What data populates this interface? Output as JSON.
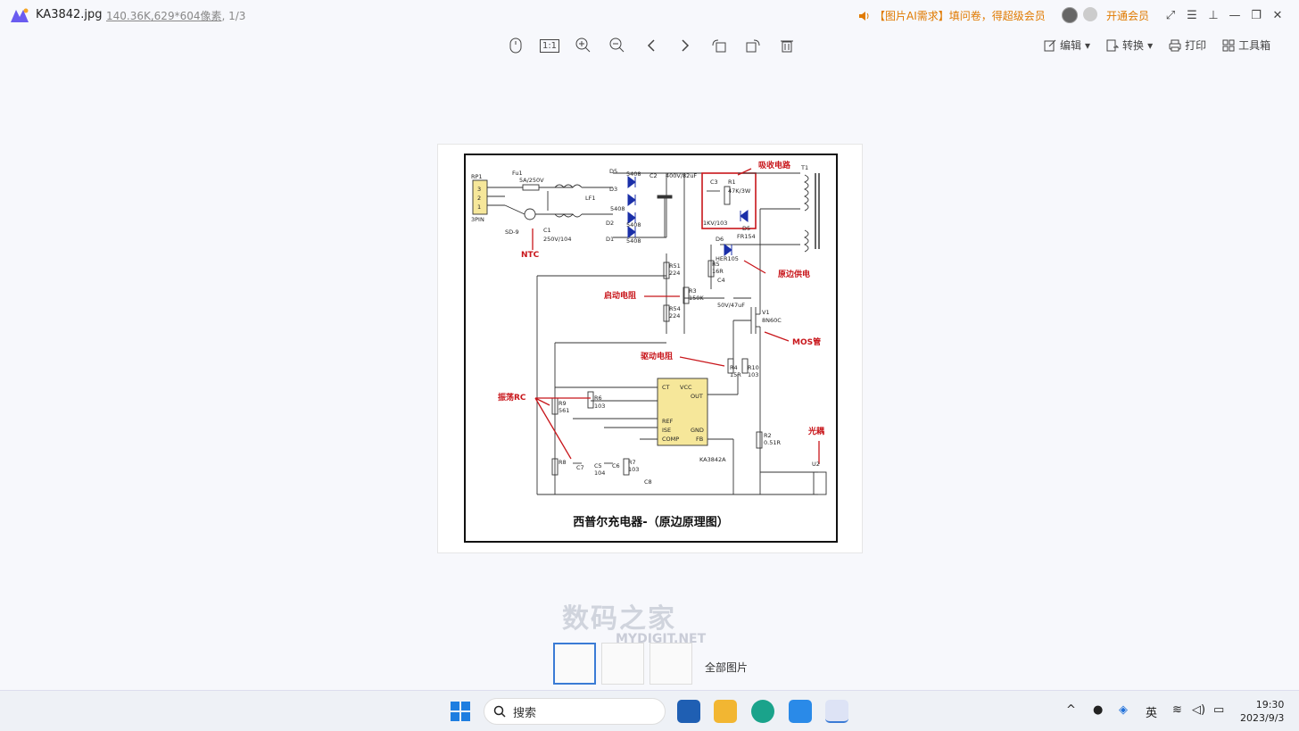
{
  "titlebar": {
    "filename": "KA3842.jpg",
    "size": "140.36K",
    "dims": ",629*604像素",
    "index": ", 1/3",
    "promo": "【图片AI需求】填问卷，得超级会员",
    "vip": "开通会员"
  },
  "toolbar": {
    "ratio_label": "1:1",
    "edit": "编辑",
    "convert": "转换",
    "print": "打印",
    "toolbox": "工具箱"
  },
  "schematic": {
    "caption": "西普尔充电器-（原边原理图）",
    "labels": {
      "rp": "RP1",
      "p3": "3",
      "p2": "2",
      "p1": "1",
      "pin": "3PIN",
      "fu": "Fu1",
      "fuv": "5A/250V",
      "sd": "SD-9",
      "ntc": "NTC",
      "c1": "C1",
      "c1v": "250V/104",
      "lf": "LF1",
      "d5": "D5",
      "d3": "D3",
      "d2": "D2",
      "d1": "D1",
      "d5v": "5408",
      "d3v": "5408",
      "d2v": "5408",
      "d1v": "5408",
      "c2": "C2",
      "c2v": "400V/82uF",
      "absorb": "吸收电路",
      "c3": "C3",
      "r1": "R1",
      "r1v": "47K/3W",
      "c3v": "1KV/103",
      "d5b": "D5",
      "fr": "FR154",
      "t1": "T1",
      "d6": "D6",
      "her": "HER105",
      "primary": "原边供电",
      "r51": "R51",
      "r51v": "224",
      "r5": "R5",
      "r5v": "16R",
      "c4": "C4",
      "startup": "启动电阻",
      "r3": "R3",
      "r3v": "150K",
      "c4v": "50V/47uF",
      "r54": "R54",
      "r54v": "224",
      "v1": "V1",
      "v1v": "8N60C",
      "mos": "MOS管",
      "drive": "驱动电阻",
      "r4": "R4",
      "r4v": "15R",
      "r10": "R10",
      "r10v": "103",
      "osc": "振荡RC",
      "r9": "R9",
      "r9v": "561",
      "r6": "R6",
      "r6v": "103",
      "ct": "CT",
      "vcc": "VCC",
      "out": "OUT",
      "ref": "REF",
      "ise": "ISE",
      "comp": "COMP",
      "gnd": "GND",
      "fb": "FB",
      "ic": "KA3842A",
      "r2": "R2",
      "r2v": "0.51R",
      "opto": "光耦",
      "u2": "U2",
      "r8": "R8",
      "c7": "C7",
      "c5": "C5",
      "c5v": "104",
      "c6": "C6",
      "r7": "R7",
      "r7v": "103",
      "c8": "C8"
    }
  },
  "watermark": {
    "text": "数码之家",
    "sub": "MYDIGIT.NET"
  },
  "thumbnails": {
    "all": "全部图片"
  },
  "taskbar": {
    "search": "搜索",
    "lang": "英",
    "time": "19:30",
    "date": "2023/9/3"
  }
}
